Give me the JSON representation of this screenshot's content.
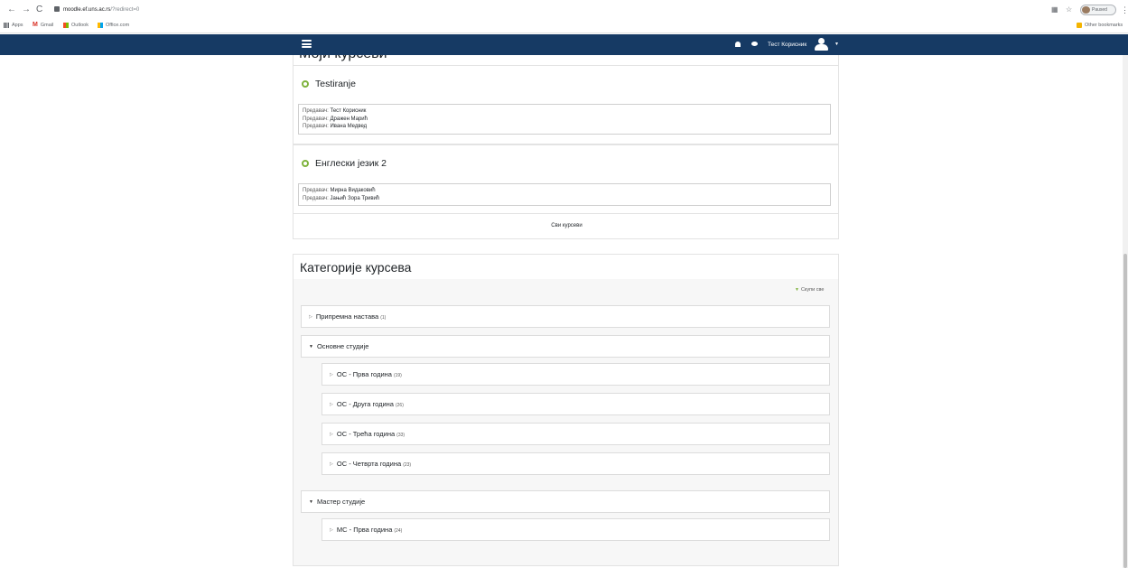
{
  "browser": {
    "url_host": "moodle.ef.uns.ac.rs",
    "url_path": "/?redirect=0",
    "profile_status": "Paused",
    "bookmarks": [
      {
        "label": "Apps",
        "icon": "apps-grid-icon"
      },
      {
        "label": "Gmail",
        "icon": "gmail-icon"
      },
      {
        "label": "Outlook",
        "icon": "outlook-icon"
      },
      {
        "label": "Office.com",
        "icon": "office-icon"
      }
    ],
    "other_bookmarks": "Other bookmarks"
  },
  "navbar": {
    "user_name": "Тест Корисник",
    "bg_color": "#163a64"
  },
  "my_courses": {
    "title": "Моји курсеви",
    "courses": [
      {
        "name": "Testiranje",
        "teachers": [
          {
            "role": "Предавач:",
            "name": "Тест Корисник"
          },
          {
            "role": "Предавач:",
            "name": "Дражен Марић"
          },
          {
            "role": "Предавач:",
            "name": "Ивана Медвед"
          }
        ]
      },
      {
        "name": "Енглески језик 2",
        "teachers": [
          {
            "role": "Предавач:",
            "name": "Мирна Видаковић"
          },
          {
            "role": "Предавач:",
            "name": "Јањић Зора Тривић"
          }
        ]
      }
    ],
    "all_courses_link": "Сви курсеви"
  },
  "categories": {
    "title": "Категорије курсева",
    "collapse_all": "Скупи све",
    "items": [
      {
        "label": "Припремна настава",
        "count": "(1)"
      },
      {
        "label": "Основне студије",
        "count": ""
      },
      {
        "label": "ОС - Прва година",
        "count": "(19)"
      },
      {
        "label": "ОС - Друга година",
        "count": "(26)"
      },
      {
        "label": "ОС - Трећа година",
        "count": "(33)"
      },
      {
        "label": "ОС - Четврта година",
        "count": "(23)"
      },
      {
        "label": "Мастер студије",
        "count": ""
      },
      {
        "label": "МС - Прва година",
        "count": "(24)"
      }
    ]
  }
}
